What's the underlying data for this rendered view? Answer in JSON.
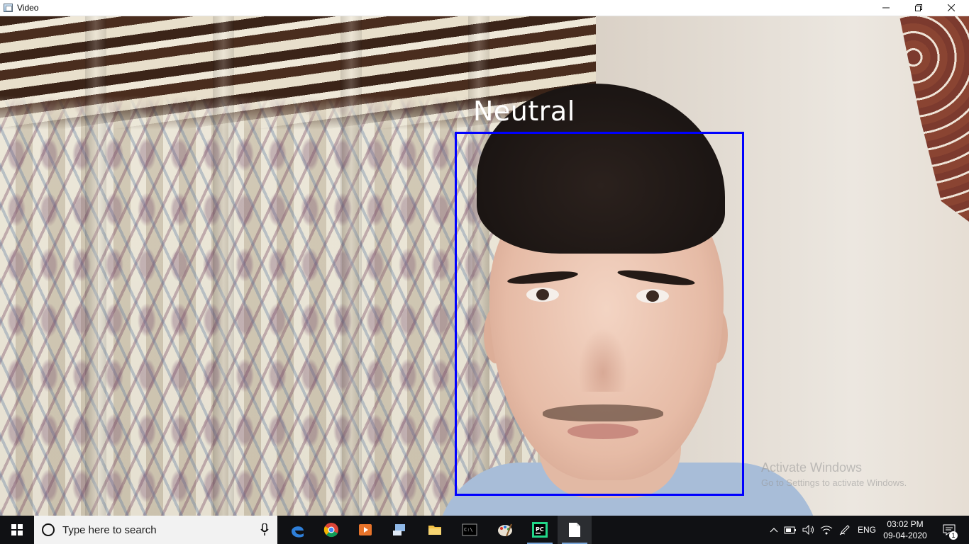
{
  "window": {
    "title": "Video",
    "controls": {
      "minimize": "minimize",
      "maximize": "restore",
      "close": "close"
    }
  },
  "video": {
    "emotion_label": "Neutral",
    "face_box_color": "#0000ff",
    "watermark": {
      "line1": "Activate Windows",
      "line2": "Go to Settings to activate Windows."
    }
  },
  "taskbar": {
    "search": {
      "placeholder": "Type here to search"
    },
    "pinned_apps": [
      {
        "name": "edge-icon",
        "open": false
      },
      {
        "name": "chrome-icon",
        "open": false
      },
      {
        "name": "media-player-icon",
        "open": false
      },
      {
        "name": "connect-icon",
        "open": false
      },
      {
        "name": "file-explorer-icon",
        "open": false
      },
      {
        "name": "terminal-icon",
        "open": false
      },
      {
        "name": "paint-icon",
        "open": false
      },
      {
        "name": "pycharm-icon",
        "open": true
      },
      {
        "name": "document-icon",
        "open": true,
        "active": true
      }
    ],
    "tray": {
      "language": "ENG",
      "time": "03:02 PM",
      "date": "09-04-2020",
      "notification_count": "1"
    }
  },
  "colors": {
    "taskbar_bg": "#101114",
    "accent": "#79a6d9"
  }
}
